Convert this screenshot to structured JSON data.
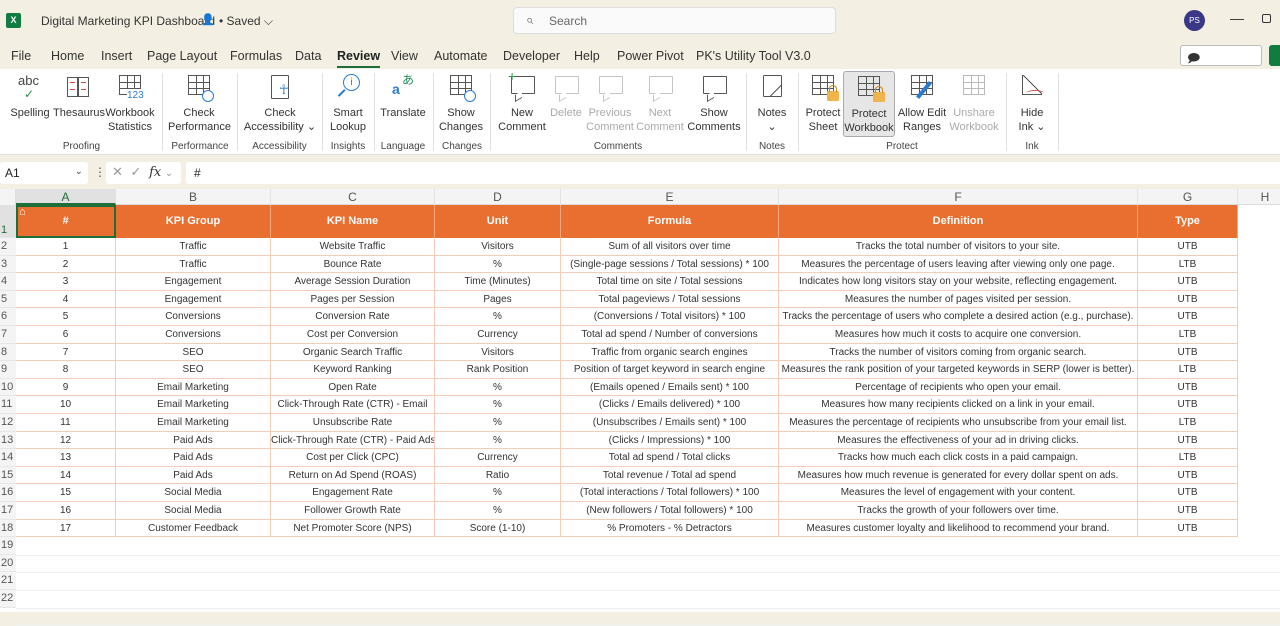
{
  "titlebar": {
    "app_icon": "excel-logo-icon",
    "app_icon_text": "X",
    "doc_title": "Digital Marketing KPI Dashboard",
    "share_icon": "people-icon",
    "save_status": "• Saved ⌵",
    "search_placeholder": "Search",
    "avatar_initials": "PS",
    "minimize": "—"
  },
  "menu": {
    "tabs": [
      "File",
      "Home",
      "Insert",
      "Page Layout",
      "Formulas",
      "Data",
      "Review",
      "View",
      "Automate",
      "Developer",
      "Help",
      "Power Pivot",
      "PK's Utility Tool V3.0"
    ],
    "active_tab": "Review",
    "comments_button": "🗩 Comments"
  },
  "ribbon": {
    "buttons": [
      {
        "id": "spelling",
        "line1": "Spelling",
        "line2": "",
        "icon_text": "abc"
      },
      {
        "id": "thesaurus",
        "line1": "Thesaurus",
        "line2": ""
      },
      {
        "id": "workbook-statistics",
        "line1": "Workbook",
        "line2": "Statistics",
        "icon_text": "123"
      },
      {
        "id": "check-performance",
        "line1": "Check",
        "line2": "Performance"
      },
      {
        "id": "check-accessibility",
        "line1": "Check",
        "line2": "Accessibility ⌄"
      },
      {
        "id": "smart-lookup",
        "line1": "Smart",
        "line2": "Lookup",
        "icon_text": "i"
      },
      {
        "id": "translate",
        "line1": "Translate",
        "line2": "",
        "icon_text": "あ"
      },
      {
        "id": "show-changes",
        "line1": "Show",
        "line2": "Changes"
      },
      {
        "id": "new-comment",
        "line1": "New",
        "line2": "Comment"
      },
      {
        "id": "delete",
        "line1": "Delete",
        "line2": ""
      },
      {
        "id": "previous-comment",
        "line1": "Previous",
        "line2": "Comment"
      },
      {
        "id": "next-comment",
        "line1": "Next",
        "line2": "Comment"
      },
      {
        "id": "show-comments",
        "line1": "Show",
        "line2": "Comments"
      },
      {
        "id": "notes",
        "line1": "Notes",
        "line2": "⌄"
      },
      {
        "id": "protect-sheet",
        "line1": "Protect",
        "line2": "Sheet"
      },
      {
        "id": "protect-workbook",
        "line1": "Protect",
        "line2": "Workbook"
      },
      {
        "id": "allow-edit-ranges",
        "line1": "Allow Edit",
        "line2": "Ranges"
      },
      {
        "id": "unshare-workbook",
        "line1": "Unshare",
        "line2": "Workbook"
      },
      {
        "id": "hide-ink",
        "line1": "Hide",
        "line2": "Ink ⌄"
      }
    ],
    "groups": [
      "Proofing",
      "Performance",
      "Accessibility",
      "Insights",
      "Language",
      "Changes",
      "Comments",
      "Notes",
      "Protect",
      "Ink"
    ]
  },
  "formula_bar": {
    "name_box": "A1",
    "chevron": "⌄",
    "dots": "⋮",
    "cancel": "✕",
    "enter": "✓",
    "fx": "fx",
    "formula": "#"
  },
  "sheet": {
    "column_letters": [
      "A",
      "B",
      "C",
      "D",
      "E",
      "F",
      "G",
      "H"
    ],
    "row_numbers": [
      "1",
      "2",
      "3",
      "4",
      "5",
      "6",
      "7",
      "8",
      "9",
      "10",
      "11",
      "12",
      "13",
      "14",
      "15",
      "16",
      "17",
      "18",
      "19",
      "20",
      "21",
      "22"
    ],
    "selected_cell": "A1",
    "header_color": "#e86f30",
    "headers": [
      "#",
      "KPI Group",
      "KPI Name",
      "Unit",
      "Formula",
      "Definition",
      "Type"
    ],
    "rows": [
      [
        "1",
        "Traffic",
        "Website Traffic",
        "Visitors",
        "Sum of all visitors over time",
        "Tracks the total number of visitors to your site.",
        "UTB"
      ],
      [
        "2",
        "Traffic",
        "Bounce Rate",
        "%",
        "(Single-page sessions / Total sessions) * 100",
        "Measures the percentage of users leaving after viewing only one page.",
        "LTB"
      ],
      [
        "3",
        "Engagement",
        "Average Session Duration",
        "Time (Minutes)",
        "Total time on site / Total sessions",
        "Indicates how long visitors stay on your website, reflecting engagement.",
        "UTB"
      ],
      [
        "4",
        "Engagement",
        "Pages per Session",
        "Pages",
        "Total pageviews / Total sessions",
        "Measures the number of pages visited per session.",
        "UTB"
      ],
      [
        "5",
        "Conversions",
        "Conversion Rate",
        "%",
        "(Conversions / Total visitors) * 100",
        "Tracks the percentage of users who complete a desired action (e.g., purchase).",
        "UTB"
      ],
      [
        "6",
        "Conversions",
        "Cost per Conversion",
        "Currency",
        "Total ad spend / Number of conversions",
        "Measures how much it costs to acquire one conversion.",
        "LTB"
      ],
      [
        "7",
        "SEO",
        "Organic Search Traffic",
        "Visitors",
        "Traffic from organic search engines",
        "Tracks the number of visitors coming from organic search.",
        "UTB"
      ],
      [
        "8",
        "SEO",
        "Keyword Ranking",
        "Rank Position",
        "Position of target keyword in search engine",
        "Measures the rank position of your targeted keywords in SERP (lower is better).",
        "LTB"
      ],
      [
        "9",
        "Email Marketing",
        "Open Rate",
        "%",
        "(Emails opened / Emails sent) * 100",
        "Percentage of recipients who open your email.",
        "UTB"
      ],
      [
        "10",
        "Email Marketing",
        "Click-Through Rate (CTR) - Email",
        "%",
        "(Clicks / Emails delivered) * 100",
        "Measures how many recipients clicked on a link in your email.",
        "UTB"
      ],
      [
        "11",
        "Email Marketing",
        "Unsubscribe Rate",
        "%",
        "(Unsubscribes / Emails sent) * 100",
        "Measures the percentage of recipients who unsubscribe from your email list.",
        "LTB"
      ],
      [
        "12",
        "Paid Ads",
        "Click-Through Rate (CTR) - Paid Ads",
        "%",
        "(Clicks / Impressions) * 100",
        "Measures the effectiveness of your ad in driving clicks.",
        "UTB"
      ],
      [
        "13",
        "Paid Ads",
        "Cost per Click (CPC)",
        "Currency",
        "Total ad spend / Total clicks",
        "Tracks how much each click costs in a paid campaign.",
        "LTB"
      ],
      [
        "14",
        "Paid Ads",
        "Return on Ad Spend (ROAS)",
        "Ratio",
        "Total revenue / Total ad spend",
        "Measures how much revenue is generated for every dollar spent on ads.",
        "UTB"
      ],
      [
        "15",
        "Social Media",
        "Engagement Rate",
        "%",
        "(Total interactions / Total followers) * 100",
        "Measures the level of engagement with your content.",
        "UTB"
      ],
      [
        "16",
        "Social Media",
        "Follower Growth Rate",
        "%",
        "(New followers / Total followers) * 100",
        "Tracks the growth of your followers over time.",
        "UTB"
      ],
      [
        "17",
        "Customer Feedback",
        "Net Promoter Score (NPS)",
        "Score (1-10)",
        "% Promoters - % Detractors",
        "Measures customer loyalty and likelihood to recommend your brand.",
        "UTB"
      ]
    ]
  }
}
